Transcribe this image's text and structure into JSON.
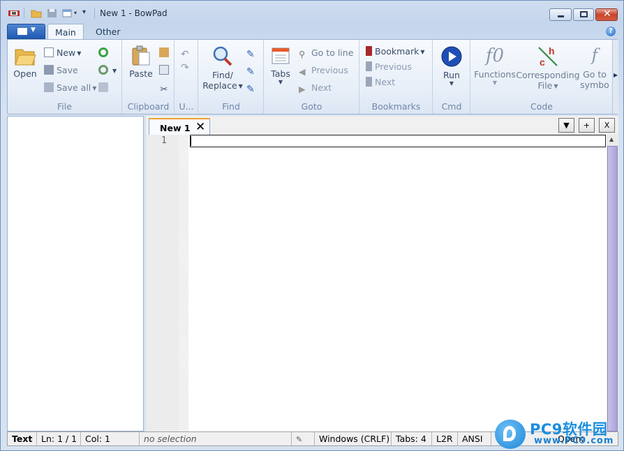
{
  "window": {
    "title": "New 1 - BowPad"
  },
  "ribbon_tabs": [
    {
      "label": "Main"
    },
    {
      "label": "Other"
    }
  ],
  "groups": {
    "file": {
      "label": "File",
      "open": "Open",
      "new": "New",
      "save": "Save",
      "save_all": "Save all"
    },
    "clipboard": {
      "label": "Clipboard",
      "paste": "Paste"
    },
    "undo": {
      "label": "U..."
    },
    "find": {
      "label": "Find",
      "find_replace_1": "Find/",
      "find_replace_2": "Replace"
    },
    "goto": {
      "label": "Goto",
      "tabs": "Tabs",
      "go_to_line": "Go to line",
      "previous": "Previous",
      "next": "Next"
    },
    "bookmarks": {
      "label": "Bookmarks",
      "bookmark": "Bookmark",
      "previous": "Previous",
      "next": "Next"
    },
    "cmd": {
      "label": "Cmd",
      "run": "Run"
    },
    "code": {
      "label": "Code",
      "functions": "Functions",
      "corresponding_1": "Corresponding",
      "corresponding_2": "File",
      "goto_symbol_1": "Go to",
      "goto_symbol_2": "symbo"
    }
  },
  "editor": {
    "tab_label": "New 1",
    "tab_close": "✕",
    "tools": [
      "▼",
      "+",
      "X"
    ],
    "line_numbers": [
      "1"
    ]
  },
  "statusbar": {
    "lexer": "Text",
    "ln": "Ln: 1 / 1",
    "col": "Col: 1",
    "selection": "no selection",
    "eol": "Windows (CRLF)",
    "tabs": "Tabs: 4",
    "direction": "L2R",
    "encoding": "ANSI",
    "open": "Open:"
  },
  "watermark": {
    "brand": "PC9软件园",
    "url": "www.PC9.com"
  },
  "colors": {
    "accent": "#1f5bb3",
    "tab_marker": "#f0a030",
    "scroll_thumb": "#a9a2d8"
  }
}
